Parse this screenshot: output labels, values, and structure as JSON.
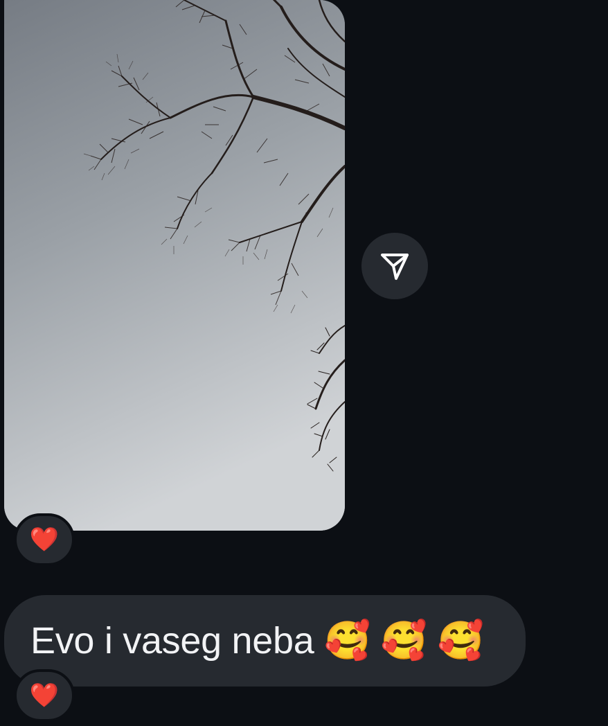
{
  "messages": [
    {
      "type": "photo",
      "description": "",
      "reaction": "❤️"
    },
    {
      "type": "text",
      "text": "Evo i vaseg neba 🥰 🥰 🥰",
      "reaction": "❤️"
    }
  ],
  "actions": {
    "share_icon": "share-icon"
  },
  "colors": {
    "background": "#0c0f14",
    "bubble": "#262a30",
    "text": "#f2f3f5",
    "heart": "#e8283a"
  }
}
